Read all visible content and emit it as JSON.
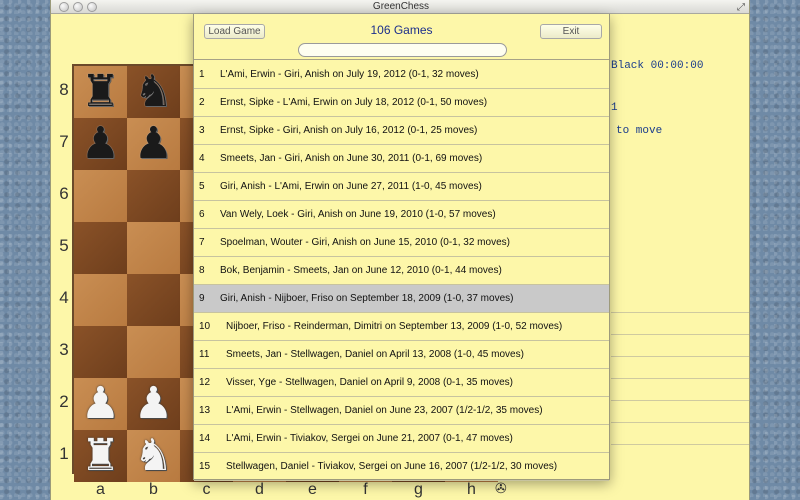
{
  "window": {
    "title": "GreenChess"
  },
  "game_list": {
    "load_button": "Load Game",
    "exit_button": "Exit",
    "count": "106 Games",
    "search_value": "",
    "selected_index": 8,
    "games": [
      {
        "num": "1",
        "text": "L'Ami, Erwin - Giri, Anish on July 19, 2012 (0-1, 32 moves)"
      },
      {
        "num": "2",
        "text": "Ernst, Sipke - L'Ami, Erwin on July 18, 2012 (0-1, 50 moves)"
      },
      {
        "num": "3",
        "text": "Ernst, Sipke - Giri, Anish on July 16, 2012 (0-1, 25 moves)"
      },
      {
        "num": "4",
        "text": "Smeets, Jan - Giri, Anish on June 30, 2011 (0-1, 69 moves)"
      },
      {
        "num": "5",
        "text": "Giri, Anish - L'Ami, Erwin on June 27, 2011 (1-0, 45 moves)"
      },
      {
        "num": "6",
        "text": "Van Wely, Loek - Giri, Anish on June 19, 2010 (1-0, 57 moves)"
      },
      {
        "num": "7",
        "text": "Spoelman, Wouter - Giri, Anish on June 15, 2010 (0-1, 32 moves)"
      },
      {
        "num": "8",
        "text": "Bok, Benjamin - Smeets, Jan on June 12, 2010 (0-1, 44 moves)"
      },
      {
        "num": "9",
        "text": "Giri, Anish - Nijboer, Friso on September 18, 2009 (1-0, 37 moves)"
      },
      {
        "num": "10",
        "text": "Nijboer, Friso - Reinderman, Dimitri on September 13, 2009 (1-0, 52 moves)"
      },
      {
        "num": "11",
        "text": "Smeets, Jan - Stellwagen, Daniel on April 13, 2008 (1-0, 45 moves)"
      },
      {
        "num": "12",
        "text": "Visser, Yge - Stellwagen, Daniel on April 9, 2008 (0-1, 35 moves)"
      },
      {
        "num": "13",
        "text": "L'Ami, Erwin - Stellwagen, Daniel on June 23, 2007 (1/2-1/2, 35 moves)"
      },
      {
        "num": "14",
        "text": "L'Ami, Erwin - Tiviakov, Sergei on June 21, 2007 (0-1, 47 moves)"
      },
      {
        "num": "15",
        "text": "Stellwagen, Daniel - Tiviakov, Sergei on June 16, 2007 (1/2-1/2, 30 moves)"
      }
    ]
  },
  "board": {
    "ranks": [
      "8",
      "7",
      "6",
      "5",
      "4",
      "3",
      "2",
      "1"
    ],
    "files": [
      "a",
      "b",
      "c",
      "d",
      "e",
      "f",
      "g",
      "h"
    ],
    "pieces": [
      {
        "square": "a8",
        "glyph": "♜",
        "color": "black",
        "name": "black-rook"
      },
      {
        "square": "b8",
        "glyph": "♞",
        "color": "black",
        "name": "black-knight"
      },
      {
        "square": "a7",
        "glyph": "♟",
        "color": "black",
        "name": "black-pawn"
      },
      {
        "square": "b7",
        "glyph": "♟",
        "color": "black",
        "name": "black-pawn"
      },
      {
        "square": "a2",
        "glyph": "♟",
        "color": "white",
        "name": "white-pawn"
      },
      {
        "square": "b2",
        "glyph": "♟",
        "color": "white",
        "name": "white-pawn"
      },
      {
        "square": "a1",
        "glyph": "♜",
        "color": "white",
        "name": "white-rook"
      },
      {
        "square": "b1",
        "glyph": "♞",
        "color": "white",
        "name": "white-knight"
      }
    ],
    "flip_icon": "✇"
  },
  "notation": {
    "clock_text": "Black 00:00:00",
    "partial_digit": "1",
    "to_move_text": "to move"
  }
}
